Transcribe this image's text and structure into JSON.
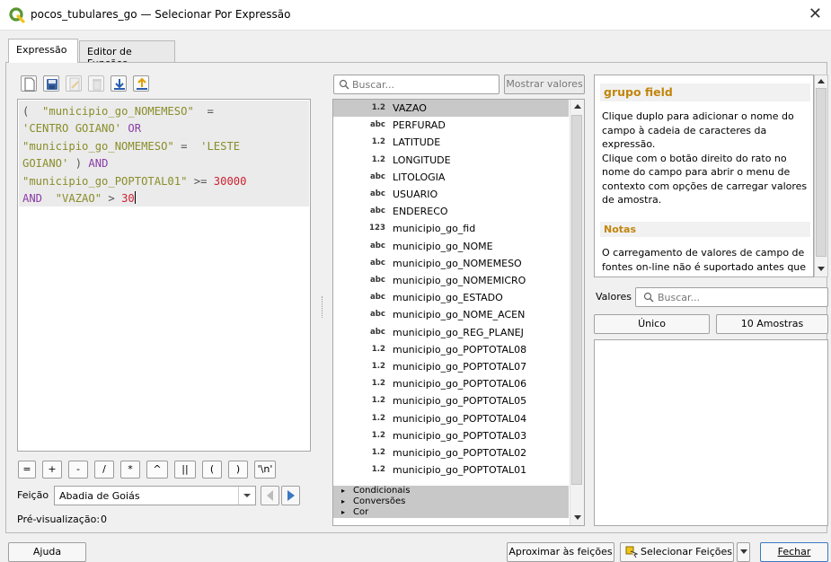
{
  "window": {
    "title": "pocos_tubulares_go — Selecionar Por Expressão",
    "close_glyph": "✕"
  },
  "tabs": [
    {
      "label": "Expressão"
    },
    {
      "label": "Editor de Funções"
    }
  ],
  "editor": {
    "lines": [
      [
        {
          "c": "cop",
          "t": "(  "
        },
        {
          "c": "cstr",
          "t": "\"municipio_go_NOMEMESO\""
        },
        {
          "c": "cop",
          "t": "  ="
        }
      ],
      [
        {
          "c": "cstr",
          "t": "'CENTRO GOIANO'"
        },
        {
          "c": "ckw",
          "t": " OR"
        }
      ],
      [
        {
          "c": "cstr",
          "t": "\"municipio_go_NOMEMESO\""
        },
        {
          "c": "cop",
          "t": " =  "
        },
        {
          "c": "cstr",
          "t": "'LESTE"
        }
      ],
      [
        {
          "c": "cstr",
          "t": "GOIANO'"
        },
        {
          "c": "cop",
          "t": " ) "
        },
        {
          "c": "ckw",
          "t": "AND"
        }
      ],
      [
        {
          "c": "cstr",
          "t": "\"municipio_go_POPTOTAL01\""
        },
        {
          "c": "cop",
          "t": " >= "
        },
        {
          "c": "cnum",
          "t": "30000"
        }
      ],
      [
        {
          "c": "ckw",
          "t": "AND"
        },
        {
          "c": "cop",
          "t": "  "
        },
        {
          "c": "cstr",
          "t": "\"VAZAO\""
        },
        {
          "c": "cop",
          "t": " > "
        },
        {
          "c": "cnum",
          "t": "30"
        }
      ]
    ]
  },
  "operators": [
    "=",
    "+",
    "-",
    "/",
    "*",
    "^",
    "||",
    "(",
    ")",
    "'\\n'"
  ],
  "feature": {
    "label": "Feição",
    "value": "Abadia de Goiás"
  },
  "preview": {
    "label": "Pré-visualização:",
    "value": "0"
  },
  "search": {
    "placeholder": "Buscar..."
  },
  "show_values_label": "Mostrar valores",
  "fields": [
    {
      "type": "1.2",
      "name": "VAZAO"
    },
    {
      "type": "abc",
      "name": "PERFURAD"
    },
    {
      "type": "1.2",
      "name": "LATITUDE"
    },
    {
      "type": "1.2",
      "name": "LONGITUDE"
    },
    {
      "type": "abc",
      "name": "LITOLOGIA"
    },
    {
      "type": "abc",
      "name": "USUARIO"
    },
    {
      "type": "abc",
      "name": "ENDERECO"
    },
    {
      "type": "123",
      "name": "municipio_go_fid"
    },
    {
      "type": "abc",
      "name": "municipio_go_NOME"
    },
    {
      "type": "abc",
      "name": "municipio_go_NOMEMESO"
    },
    {
      "type": "abc",
      "name": "municipio_go_NOMEMICRO"
    },
    {
      "type": "abc",
      "name": "municipio_go_ESTADO"
    },
    {
      "type": "abc",
      "name": "municipio_go_NOME_ACEN"
    },
    {
      "type": "abc",
      "name": "municipio_go_REG_PLANEJ"
    },
    {
      "type": "1.2",
      "name": "municipio_go_POPTOTAL08"
    },
    {
      "type": "1.2",
      "name": "municipio_go_POPTOTAL07"
    },
    {
      "type": "1.2",
      "name": "municipio_go_POPTOTAL06"
    },
    {
      "type": "1.2",
      "name": "municipio_go_POPTOTAL05"
    },
    {
      "type": "1.2",
      "name": "municipio_go_POPTOTAL04"
    },
    {
      "type": "1.2",
      "name": "municipio_go_POPTOTAL03"
    },
    {
      "type": "1.2",
      "name": "municipio_go_POPTOTAL02"
    },
    {
      "type": "1.2",
      "name": "municipio_go_POPTOTAL01"
    }
  ],
  "groups": [
    {
      "name": "Condicionais"
    },
    {
      "name": "Conversões"
    },
    {
      "name": "Cor"
    }
  ],
  "help": {
    "title": "grupo field",
    "line1": "Clique duplo para adicionar o nome do",
    "line2": "campo à cadeia de caracteres da",
    "line3": "expressão.",
    "line4": "Clique com o botão direito do rato no",
    "line5": "nome do campo para abrir o menu de",
    "line6": "contexto com opções de carregar valores",
    "line7": "de amostra.",
    "notes_title": "Notas",
    "notes_line1": "O carregamento de valores de campo de",
    "notes_line2": "fontes on-line não é suportado antes que"
  },
  "values": {
    "label": "Valores",
    "placeholder": "Buscar...",
    "unique_label": "Único",
    "sample_label": "10 Amostras"
  },
  "bottom": {
    "help_label": "Ajuda",
    "zoom_label": "Aproximar às feições",
    "select_label": "Selecionar Feições",
    "close_label": "Fechar"
  },
  "colors": {
    "qgis_green": "#589632",
    "accent_yellow": "#c2860c",
    "keyword": "#8a3ca6",
    "string": "#8a8d2a",
    "number": "#cc2233"
  }
}
